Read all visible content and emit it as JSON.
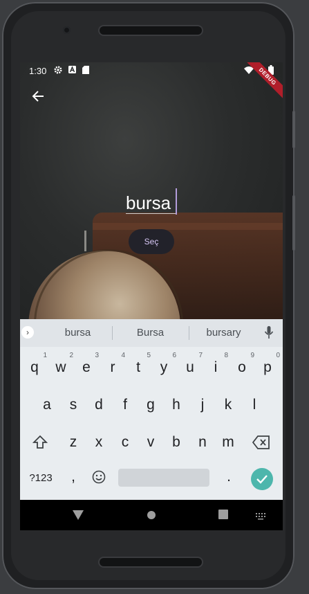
{
  "status_bar": {
    "time": "1:30",
    "debug_banner": "DEBUG"
  },
  "main": {
    "city_input_value": "bursa",
    "select_button_label": "Seç"
  },
  "keyboard": {
    "suggestions": [
      "bursa",
      "Bursa",
      "bursary"
    ],
    "row1": [
      {
        "key": "q",
        "hint": "1"
      },
      {
        "key": "w",
        "hint": "2"
      },
      {
        "key": "e",
        "hint": "3"
      },
      {
        "key": "r",
        "hint": "4"
      },
      {
        "key": "t",
        "hint": "5"
      },
      {
        "key": "y",
        "hint": "6"
      },
      {
        "key": "u",
        "hint": "7"
      },
      {
        "key": "i",
        "hint": "8"
      },
      {
        "key": "o",
        "hint": "9"
      },
      {
        "key": "p",
        "hint": "0"
      }
    ],
    "row2": [
      "a",
      "s",
      "d",
      "f",
      "g",
      "h",
      "j",
      "k",
      "l"
    ],
    "row3": [
      "z",
      "x",
      "c",
      "v",
      "b",
      "n",
      "m"
    ],
    "symbols_key": "?123",
    "comma_key": ",",
    "period_key": "."
  },
  "colors": {
    "accent_caret": "#b39ddb",
    "enter_key": "#4db6ac",
    "debug_banner": "#b01e2a",
    "button_bg": "#22222a"
  },
  "icons": {
    "back": "arrow-left-icon",
    "settings": "gear-icon",
    "a_icon": "a-letter-icon",
    "sd_card": "sd-card-icon",
    "wifi": "wifi-icon",
    "battery": "battery-icon",
    "shift": "shift-icon",
    "backspace": "backspace-icon",
    "emoji": "emoji-icon",
    "mic": "mic-icon",
    "enter": "check-icon",
    "expand": "chevron-right-icon",
    "nav_back": "triangle-back-icon",
    "nav_home": "home-circle-icon",
    "nav_recents": "square-recents-icon",
    "nav_keyboard": "keyboard-icon"
  }
}
